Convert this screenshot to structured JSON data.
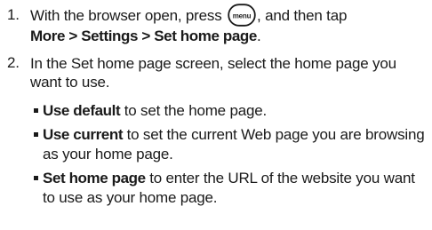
{
  "steps": [
    {
      "number": "1.",
      "before_icon": "With the browser open, press",
      "icon_label": "menu",
      "after_icon": ", and then tap",
      "path": "More > Settings > Set home page",
      "end": "."
    },
    {
      "number": "2.",
      "text": "In the Set home page screen, select the home page you want to use."
    }
  ],
  "options": [
    {
      "term": "Use default",
      "desc": " to set the home page."
    },
    {
      "term": "Use current",
      "desc": " to set the current Web page you are browsing as your home page."
    },
    {
      "term": "Set home page",
      "desc": " to enter the URL of the website you want to use as your home page."
    }
  ]
}
